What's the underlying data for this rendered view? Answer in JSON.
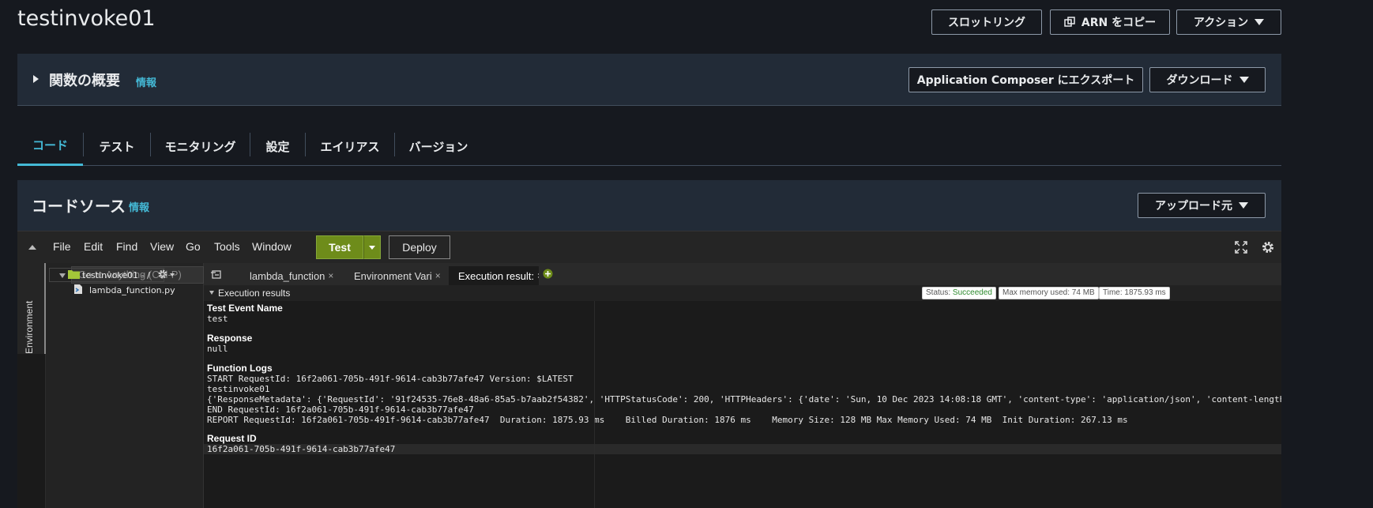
{
  "header": {
    "title": "testinvoke01",
    "throttle_label": "スロットリング",
    "copy_arn_label": "ARN をコピー",
    "actions_label": "アクション"
  },
  "overview": {
    "title": "関数の概要",
    "info_label": "情報",
    "export_label": "Application Composer にエクスポート",
    "download_label": "ダウンロード"
  },
  "tabs": [
    {
      "label": "コード"
    },
    {
      "label": "テスト"
    },
    {
      "label": "モニタリング"
    },
    {
      "label": "設定"
    },
    {
      "label": "エイリアス"
    },
    {
      "label": "バージョン"
    }
  ],
  "code_source": {
    "title": "コードソース",
    "info_label": "情報",
    "upload_label": "アップロード元"
  },
  "ide": {
    "menu": [
      "File",
      "Edit",
      "Find",
      "View",
      "Go",
      "Tools",
      "Window"
    ],
    "test_label": "Test",
    "deploy_label": "Deploy",
    "goto_placeholder": "Go to Anything (Ctrl-P)",
    "env_label": "Environment",
    "tree_root": "testinvoke01 - /",
    "tree_file": "lambda_function.py",
    "file_tabs": [
      "lambda_function",
      "Environment Vari",
      "Execution result:"
    ],
    "results": {
      "header_label": "Execution results",
      "status_prefix": "Status: ",
      "status_value": "Succeeded",
      "memory_label": "Max memory used: 74 MB",
      "time_label": "Time: 1875.93 ms",
      "test_event_name_label": "Test Event Name",
      "test_event_name": "test",
      "response_label": "Response",
      "response": "null",
      "function_logs_label": "Function Logs",
      "logs": [
        "START RequestId: 16f2a061-705b-491f-9614-cab3b77afe47 Version: $LATEST",
        "testinvoke01",
        "{'ResponseMetadata': {'RequestId': '91f24535-76e8-48a6-85a5-b7aab2f54382', 'HTTPStatusCode': 200, 'HTTPHeaders': {'date': 'Sun, 10 Dec 2023 14:08:18 GMT', 'content-type': 'application/json', 'content-length",
        "END RequestId: 16f2a061-705b-491f-9614-cab3b77afe47",
        "REPORT RequestId: 16f2a061-705b-491f-9614-cab3b77afe47  Duration: 1875.93 ms    Billed Duration: 1876 ms    Memory Size: 128 MB Max Memory Used: 74 MB  Init Duration: 267.13 ms"
      ],
      "request_id_label": "Request ID",
      "request_id": "16f2a061-705b-491f-9614-cab3b77afe47"
    }
  },
  "colors": {
    "accent": "#44b9d6",
    "test_green": "#6e8c1a",
    "status_green": "#2e8b2e"
  }
}
